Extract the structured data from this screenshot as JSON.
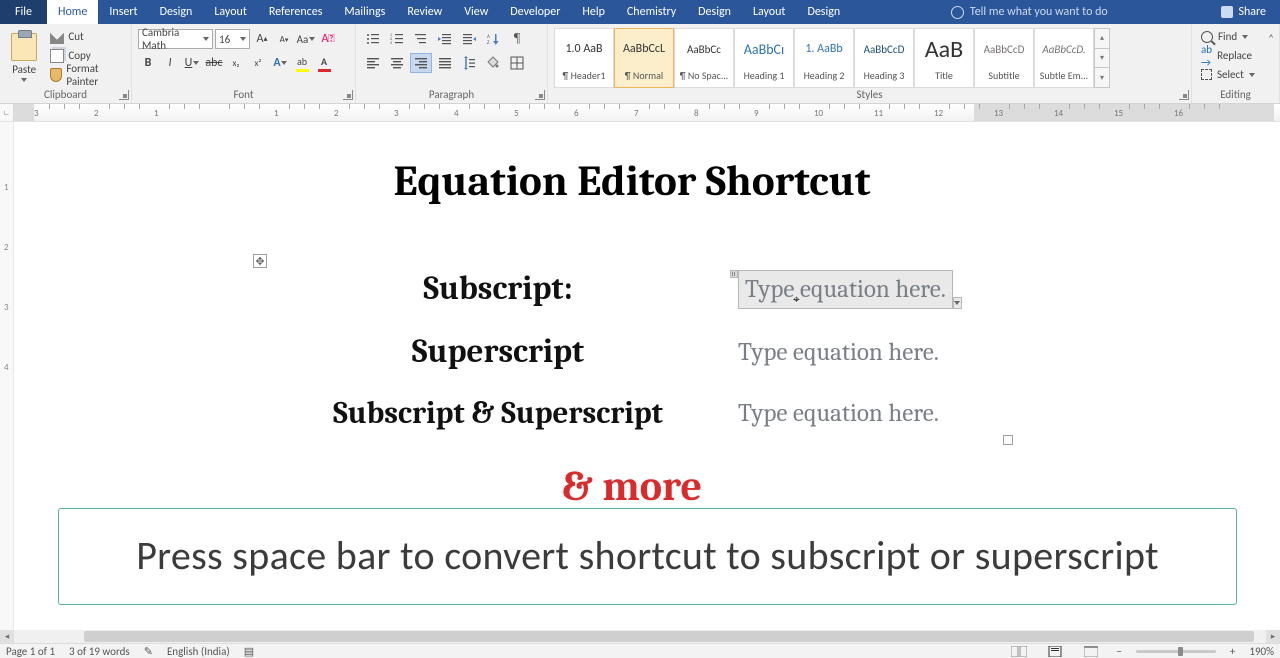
{
  "tabs": {
    "file": "File",
    "home": "Home",
    "insert": "Insert",
    "design": "Design",
    "layout": "Layout",
    "references": "References",
    "mailings": "Mailings",
    "review": "Review",
    "view": "View",
    "developer": "Developer",
    "help": "Help",
    "chemistry": "Chemistry",
    "design2": "Design",
    "layout2": "Layout",
    "design3": "Design"
  },
  "tell_me": "Tell me what you want to do",
  "share": "Share",
  "clipboard": {
    "label": "Clipboard",
    "paste": "Paste",
    "cut": "Cut",
    "copy": "Copy",
    "format_painter": "Format Painter"
  },
  "font": {
    "label": "Font",
    "name": "Cambria Math",
    "size": "16"
  },
  "paragraph": {
    "label": "Paragraph"
  },
  "styles": {
    "label": "Styles",
    "items": [
      {
        "sample": "1.0  AaB",
        "name": "¶ Header1",
        "cls": "samp-head1"
      },
      {
        "sample": "AaBbCcL",
        "name": "¶ Normal",
        "cls": "",
        "sel": true
      },
      {
        "sample": "AaBbCc",
        "name": "¶ No Spac...",
        "cls": "samp-nospac"
      },
      {
        "sample": "AaBbCı",
        "name": "Heading 1",
        "cls": "samp-h1"
      },
      {
        "sample": "1. AaBb",
        "name": "Heading 2",
        "cls": "samp-h2"
      },
      {
        "sample": "AaBbCcD",
        "name": "Heading 3",
        "cls": "samp-h3"
      },
      {
        "sample": "AaB",
        "name": "Title",
        "cls": "samp-title"
      },
      {
        "sample": "AaBbCcD",
        "name": "Subtitle",
        "cls": "samp-sub"
      },
      {
        "sample": "AaBbCcD.",
        "name": "Subtle Em...",
        "cls": "samp-se"
      }
    ]
  },
  "editing": {
    "label": "Editing",
    "find": "Find",
    "replace": "Replace",
    "select": "Select"
  },
  "ruler_ticks": [
    "3",
    "2",
    "1",
    "",
    "1",
    "2",
    "3",
    "4",
    "5",
    "6",
    "7",
    "8",
    "9",
    "10",
    "11",
    "12",
    "13",
    "14",
    "15",
    "16"
  ],
  "document": {
    "title": "Equation Editor Shortcut",
    "rows": [
      {
        "label": "Subscript:",
        "eq": "Type equation here.",
        "active": true
      },
      {
        "label": "Superscript",
        "eq": "Type equation here."
      },
      {
        "label": "Subscript & Superscript",
        "eq": "Type equation here."
      }
    ],
    "and_more": "& more",
    "callout": "Press space bar to convert shortcut to subscript or superscript"
  },
  "status": {
    "page": "Page 1 of 1",
    "words": "3 of 19 words",
    "lang": "English (India)",
    "zoom": "190%"
  }
}
